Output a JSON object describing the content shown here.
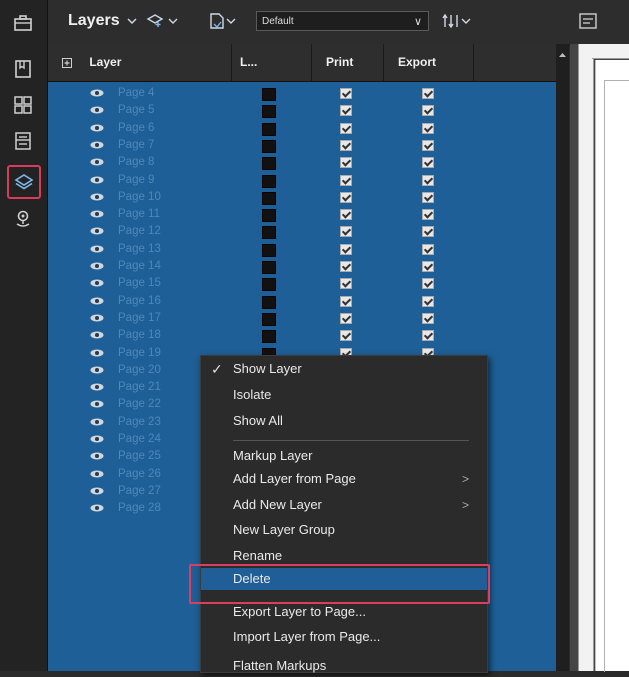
{
  "left_toolbar": {
    "icons": [
      "briefcase-icon",
      "bookmark-icon",
      "thumbnails-icon",
      "properties-icon",
      "layers-icon",
      "location-icon"
    ],
    "active": "layers-icon"
  },
  "panel": {
    "title": "Layers",
    "preset": "Default"
  },
  "table": {
    "headers": {
      "layer": "Layer",
      "lock": "L...",
      "print": "Print",
      "export": "Export"
    },
    "rows": [
      "Page 4",
      "Page 5",
      "Page 6",
      "Page 7",
      "Page 8",
      "Page 9",
      "Page 10",
      "Page 11",
      "Page 12",
      "Page 13",
      "Page 14",
      "Page 15",
      "Page 16",
      "Page 17",
      "Page 18",
      "Page 19",
      "Page 20",
      "Page 21",
      "Page 22",
      "Page 23",
      "Page 24",
      "Page 25",
      "Page 26",
      "Page 27",
      "Page 28"
    ]
  },
  "context_menu": {
    "show_layer": "Show Layer",
    "isolate": "Isolate",
    "show_all": "Show All",
    "markup_layer": "Markup Layer",
    "add_layer_from_page": "Add Layer from Page",
    "add_new_layer": "Add New Layer",
    "new_layer_group": "New Layer Group",
    "rename": "Rename",
    "delete": "Delete",
    "export_layer_to_page": "Export Layer to Page...",
    "import_layer_from_page": "Import Layer from Page...",
    "flatten_markups": "Flatten Markups"
  },
  "colors": {
    "selection": "#1d5f96",
    "highlight_outline": "#d93b5a",
    "menu_bg": "#2b2b2b"
  }
}
